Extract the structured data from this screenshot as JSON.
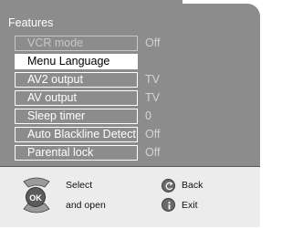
{
  "header": {
    "title": "Features"
  },
  "menu": {
    "items": [
      {
        "label": "VCR mode",
        "value": "Off",
        "state": "disabled"
      },
      {
        "label": "Menu Language",
        "value": "",
        "state": "selected"
      },
      {
        "label": "AV2 output",
        "value": "TV",
        "state": "normal"
      },
      {
        "label": "AV output",
        "value": "TV",
        "state": "normal"
      },
      {
        "label": "Sleep timer",
        "value": "0",
        "state": "normal"
      },
      {
        "label": "Auto Blackline Detect",
        "value": "Off",
        "state": "normal"
      },
      {
        "label": "Parental lock",
        "value": "Off",
        "state": "normal"
      }
    ]
  },
  "footer": {
    "ok_label": "OK",
    "select_label": "Select",
    "open_label": "and open",
    "back_label": "Back",
    "exit_label": "Exit"
  },
  "icons": {
    "nav_pad": "navigation-pad-icon",
    "back": "back-button-icon",
    "exit": "info-exit-icon"
  }
}
